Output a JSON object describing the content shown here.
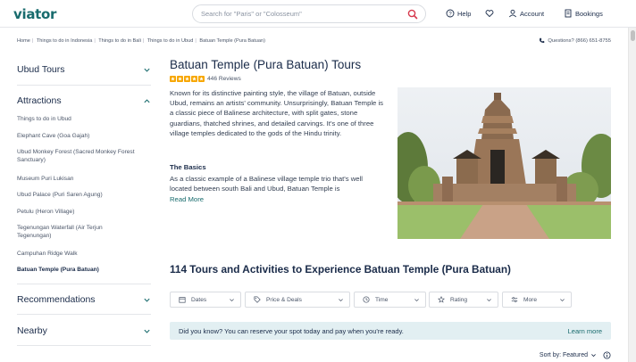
{
  "header": {
    "logo": "viator",
    "search_placeholder": "Search for \"Paris\" or \"Colosseum\"",
    "help": "Help",
    "account": "Account",
    "bookings": "Bookings"
  },
  "breadcrumb": [
    "Home",
    "Things to do in Indonesia",
    "Things to do in Bali",
    "Things to do in Ubud",
    "Batuan Temple (Pura Batuan)"
  ],
  "phone": "Questions? (866) 651-8755",
  "sidebar": {
    "sections": [
      {
        "label": "Ubud Tours"
      },
      {
        "label": "Attractions"
      },
      {
        "label": "Recommendations"
      },
      {
        "label": "Nearby"
      }
    ],
    "attractions": [
      "Things to do in Ubud",
      "Elephant Cave (Goa Gajah)",
      "Ubud Monkey Forest (Sacred Monkey Forest Sanctuary)",
      "Museum Puri Lukisan",
      "Ubud Palace (Puri Saren Agung)",
      "Petulu (Heron Village)",
      "Tegenungan Waterfall (Air Terjun Tegenungan)",
      "Campuhan Ridge Walk",
      "Batuan Temple (Pura Batuan)"
    ]
  },
  "main": {
    "title": "Batuan Temple (Pura Batuan) Tours",
    "rating": 5,
    "reviews": "446 Reviews",
    "description": "Known for its distinctive painting style, the village of Batuan, outside Ubud, remains an artists' community. Unsurprisingly, Batuan Temple is a classic piece of Balinese architecture, with split gates, stone guardians, thatched shrines, and detailed carvings. It's one of three village temples dedicated to the gods of the Hindu trinity.",
    "basics_title": "The Basics",
    "basics_text": "As a classic example of a Balinese village temple trio that's well located between south Bali and Ubud, Batuan Temple is",
    "read_more": "Read More",
    "tours_heading": "114 Tours and Activities to Experience Batuan Temple (Pura Batuan)",
    "filters": [
      "Dates",
      "Price & Deals",
      "Time",
      "Rating",
      "More"
    ],
    "banner_msg": "Did you know?  You can reserve your spot today and pay when you're ready.",
    "banner_link": "Learn more",
    "sort": "Sort by: Featured"
  },
  "colors": {
    "accent": "#186b6d",
    "star": "#f7a600",
    "banner": "#e2eff2"
  }
}
